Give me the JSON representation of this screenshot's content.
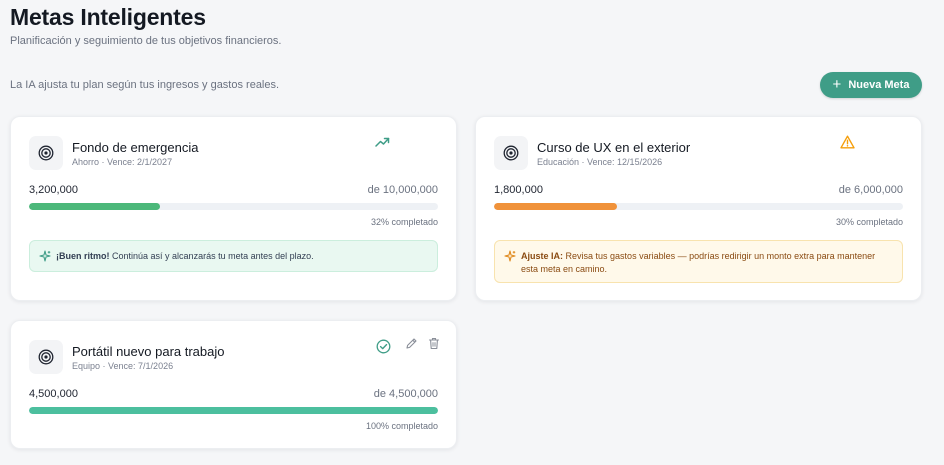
{
  "header": {
    "title": "Metas Inteligentes",
    "subtitle": "Planificación y seguimiento de tus objetivos financieros."
  },
  "toolbar": {
    "ai_note": "La IA ajusta tu plan según tus ingresos y gastos reales.",
    "new_goal_label": "Nueva Meta"
  },
  "colors": {
    "accent": "#3f9d87",
    "progress_green": "#4cb87a",
    "progress_orange": "#f0923a",
    "progress_teal": "#4cbf9e",
    "warning": "#f59e0b"
  },
  "goals": [
    {
      "name": "Fondo de emergencia",
      "meta": "Ahorro · Vence: 2/1/2027",
      "current": "3,200,000",
      "target": "de 10,000,000",
      "progress_pct": 32,
      "progress_label": "32% completado",
      "status_icon": "trending-up-icon",
      "tip_title": "¡Buen ritmo!",
      "tip_text": "Continúa así y alcanzarás tu meta antes del plazo."
    },
    {
      "name": "Curso de UX en el exterior",
      "meta": "Educación · Vence: 12/15/2026",
      "current": "1,800,000",
      "target": "de 6,000,000",
      "progress_pct": 30,
      "progress_label": "30% completado",
      "status_icon": "warning-triangle-icon",
      "tip_title": "Ajuste IA:",
      "tip_text": "Revisa tus gastos variables — podrías redirigir un monto extra para mantener esta meta en camino."
    },
    {
      "name": "Portátil nuevo para trabajo",
      "meta": "Equipo · Vence: 7/1/2026",
      "current": "4,500,000",
      "target": "de 4,500,000",
      "progress_pct": 100,
      "progress_label": "100% completado",
      "status_icon": "check-circle-icon"
    }
  ]
}
